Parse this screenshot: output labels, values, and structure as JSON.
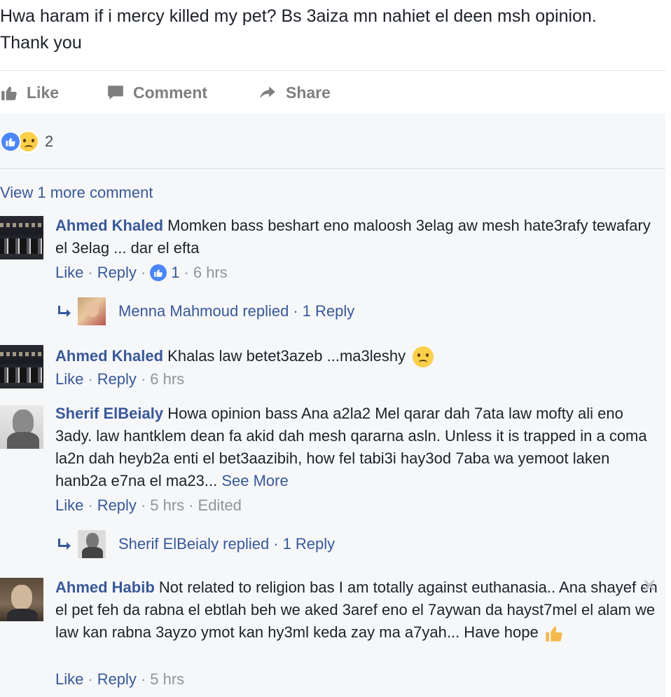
{
  "post": {
    "text": "Hwa haram if i mercy killed my pet? Bs 3aiza mn nahiet el deen msh opinion. Thank you"
  },
  "actions": {
    "like": "Like",
    "comment": "Comment",
    "share": "Share"
  },
  "reactions": {
    "icons": [
      "like-icon",
      "sad-icon"
    ],
    "count": "2"
  },
  "view_more": "View 1 more comment",
  "comments": [
    {
      "name": "Ahmed Khaled",
      "text": "Momken bass beshart eno maloosh 3elag aw mesh hate3rafy tewafary el 3elag ... dar el efta",
      "like": "Like",
      "reply": "Reply",
      "likes": "1",
      "time": "6 hrs",
      "replied": {
        "text": "Menna Mahmoud replied",
        "count": "1 Reply"
      }
    },
    {
      "name": "Ahmed Khaled",
      "text": "Khalas law betet3azeb ...ma3leshy",
      "emoji": "sad-face-icon",
      "like": "Like",
      "reply": "Reply",
      "time": "6 hrs"
    },
    {
      "name": "Sherif ElBeialy",
      "text": "Howa opinion bass Ana a2la2 Mel qarar dah 7ata law mofty ali eno 3ady. law hantklem dean fa akid dah mesh qararna asln. Unless it is trapped in a coma la2n dah heyb2a enti el bet3aazibih, how fel tabi3i hay3od 7aba wa yemoot laken hanb2a e7na el ma23...",
      "see_more": "See More",
      "like": "Like",
      "reply": "Reply",
      "time": "5 hrs",
      "edited": "Edited",
      "replied": {
        "text": "Sherif ElBeialy replied",
        "count": "1 Reply"
      }
    },
    {
      "name": "Ahmed Habib",
      "text": "Not related to religion bas I am totally against euthanasia.. Ana shayef en el pet feh da rabna el ebtlah beh we aked 3aref eno el 7aywan da hayst7mel el alam we law kan rabna 3ayzo ymot kan hy3ml keda zay ma a7yah... Have hope",
      "emoji": "thumbs-up-emoji",
      "like": "Like",
      "reply": "Reply",
      "time": "5 hrs",
      "close": "✕"
    }
  ],
  "colors": {
    "link": "#385898",
    "meta": "#90949c",
    "area_bg": "#f6f7f9",
    "like_blue": "#4a86f7",
    "sad_yellow": "#fbcf4a"
  }
}
